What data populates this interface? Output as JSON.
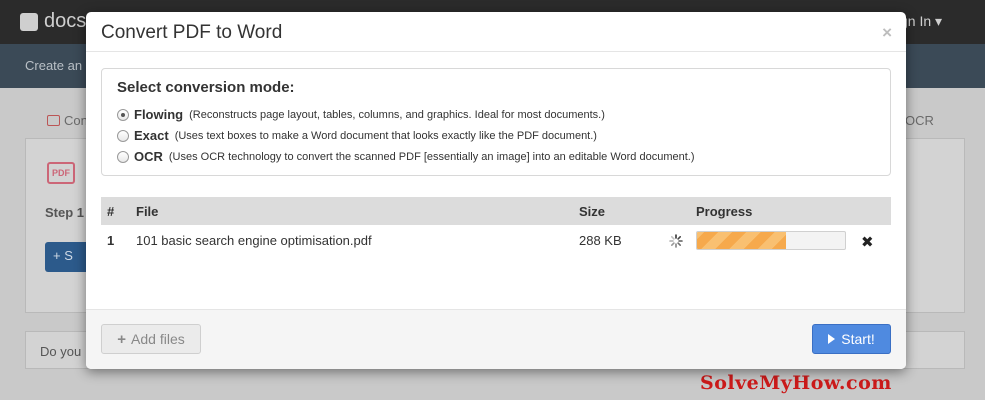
{
  "background": {
    "logo_text": "docs",
    "signin_text": "gn In ▾",
    "subbar_text": "Create an",
    "tab_left": "Con",
    "tab_right": "OCR",
    "pdf_icon_text": "PDF",
    "step_text": "Step 1",
    "button_text": "+ S",
    "ask_text": "Do you",
    "watermark": "SolveMyHow.com"
  },
  "modal": {
    "title": "Convert PDF to Word",
    "close_icon": "close-icon",
    "mode": {
      "heading": "Select conversion mode:",
      "options": [
        {
          "name": "Flowing",
          "desc": "(Reconstructs page layout, tables, columns, and graphics. Ideal for most documents.)",
          "selected": true
        },
        {
          "name": "Exact",
          "desc": "(Uses text boxes to make a Word document that looks exactly like the PDF document.)",
          "selected": false
        },
        {
          "name": "OCR",
          "desc": "(Uses OCR technology to convert the scanned PDF [essentially an image] into an editable Word document.)",
          "selected": false
        }
      ]
    },
    "table": {
      "headers": {
        "num": "#",
        "file": "File",
        "size": "Size",
        "progress": "Progress"
      },
      "rows": [
        {
          "num": "1",
          "file": "101 basic search engine optimisation.pdf",
          "size": "288 KB",
          "progress_percent": 60
        }
      ]
    },
    "footer": {
      "add_files": "Add files",
      "start": "Start!"
    },
    "colors": {
      "primary_button": "#4f8ae0",
      "progress_fill": "#f6a94c"
    }
  }
}
